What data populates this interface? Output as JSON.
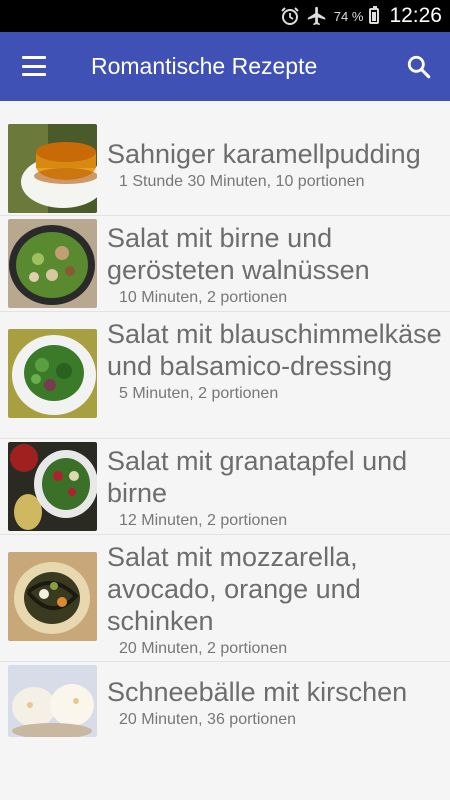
{
  "status": {
    "battery": "74 %",
    "time": "12:26"
  },
  "appbar": {
    "title": "Romantische Rezepte"
  },
  "recipes": [
    {
      "title": "Sahniger karamellpudding",
      "meta": "1 Stunde 30 Minuten, 10 portionen"
    },
    {
      "title": "Salat mit birne und gerösteten walnüssen",
      "meta": "10 Minuten, 2 portionen"
    },
    {
      "title": "Salat mit blauschimmelkäse und balsamico-dressing",
      "meta": "5 Minuten, 2 portionen"
    },
    {
      "title": "Salat mit granatapfel und birne",
      "meta": "12 Minuten, 2 portionen"
    },
    {
      "title": "Salat mit mozzarella, avocado, orange und schinken",
      "meta": "20 Minuten, 2 portionen"
    },
    {
      "title": "Schneebälle mit kirschen",
      "meta": "20 Minuten, 36 portionen"
    }
  ]
}
